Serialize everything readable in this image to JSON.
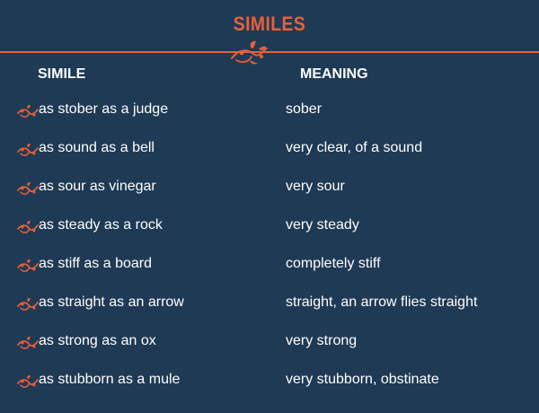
{
  "title": "SIMILES",
  "colors": {
    "background": "#1f3a54",
    "accent": "#e8603a",
    "text": "#ffffff"
  },
  "headers": {
    "simile": "SIMILE",
    "meaning": "MEANING"
  },
  "icons": {
    "title_ornament": "floral-swirl-icon",
    "row_bullet": "floral-bullet-icon"
  },
  "rows": [
    {
      "simile": "as stober as a judge",
      "meaning": "sober"
    },
    {
      "simile": "as sound as a bell",
      "meaning": "very clear, of a sound"
    },
    {
      "simile": "as sour as vinegar",
      "meaning": "very sour"
    },
    {
      "simile": "as steady as a rock",
      "meaning": "very steady"
    },
    {
      "simile": "as stiff as a board",
      "meaning": "completely stiff"
    },
    {
      "simile": "as straight as an arrow",
      "meaning": "straight, an arrow flies straight"
    },
    {
      "simile": "as strong as an ox",
      "meaning": "very strong"
    },
    {
      "simile": "as stubborn as a mule",
      "meaning": "very stubborn, obstinate"
    }
  ]
}
